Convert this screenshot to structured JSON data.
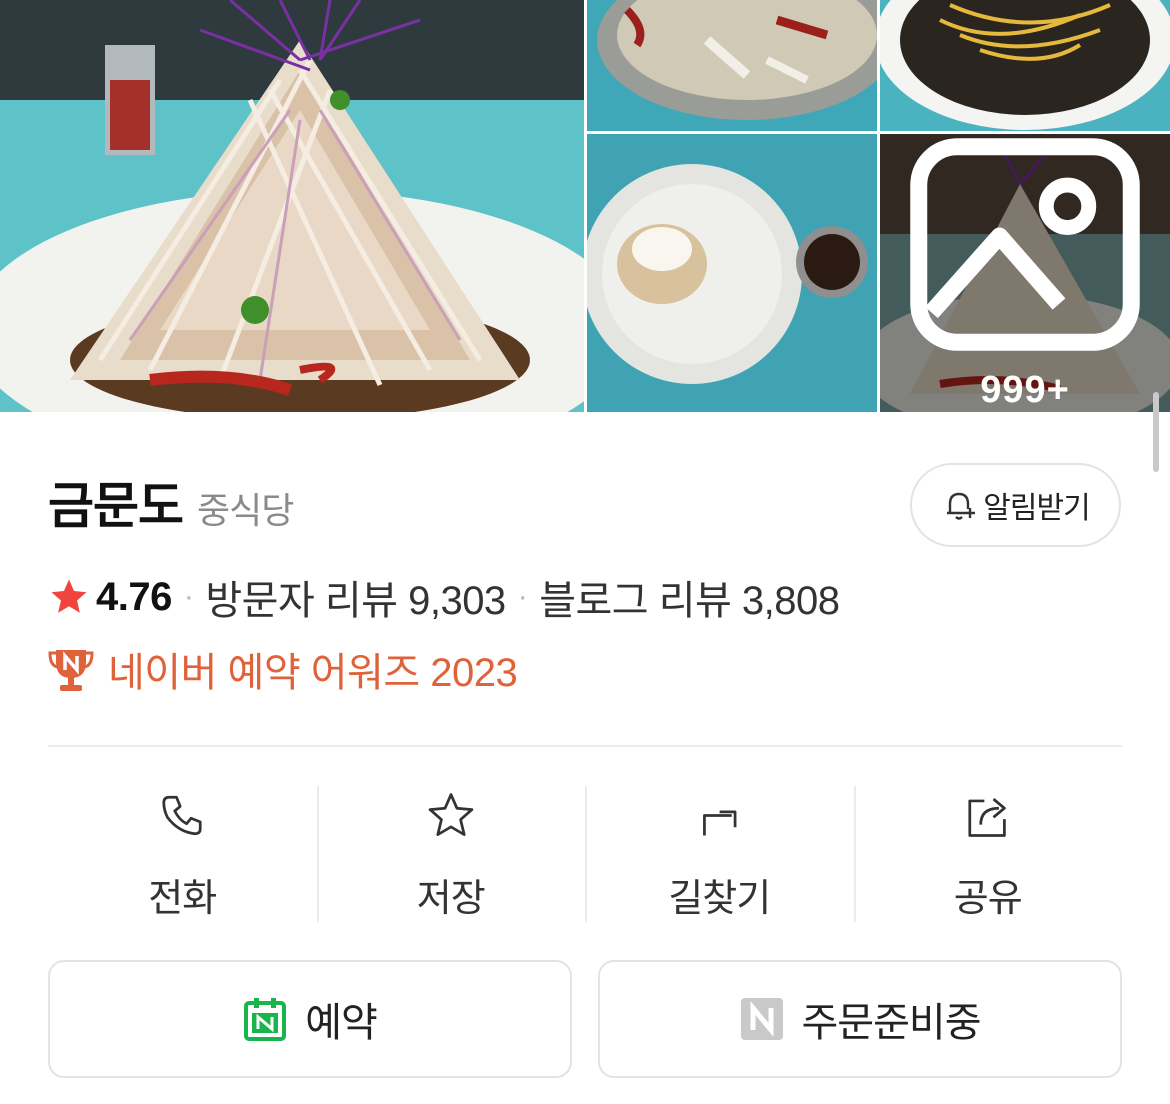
{
  "gallery": {
    "more_count": "999+",
    "icons": {
      "more": "image-icon"
    }
  },
  "place": {
    "name": "금문도",
    "category": "중식당"
  },
  "alarm_button": {
    "label": "알림받기",
    "icon": "bell-plus-icon"
  },
  "stats": {
    "rating": "4.76",
    "visitor_reviews": "방문자 리뷰 9,303",
    "blog_reviews": "블로그 리뷰 3,808",
    "separator": "·"
  },
  "award": {
    "label": "네이버 예약 어워즈 2023",
    "icon": "trophy-icon"
  },
  "actions": [
    {
      "label": "전화",
      "icon": "phone-icon"
    },
    {
      "label": "저장",
      "icon": "star-outline-icon"
    },
    {
      "label": "길찾기",
      "icon": "directions-icon"
    },
    {
      "label": "공유",
      "icon": "share-icon"
    }
  ],
  "buttons": {
    "reserve": {
      "label": "예약",
      "icon": "naver-calendar-icon"
    },
    "order": {
      "label": "주문준비중",
      "icon": "naver-n-icon"
    }
  },
  "colors": {
    "star": "#f0443c",
    "award": "#e0623a",
    "naver_green": "#19b44b",
    "border": "#e3e3e3"
  }
}
